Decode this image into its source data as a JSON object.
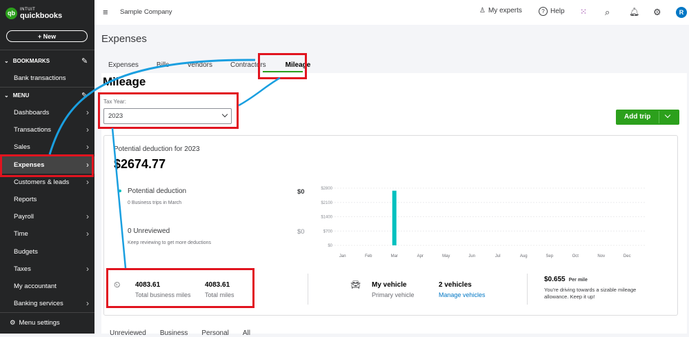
{
  "app": {
    "logo_top": "INTUIT",
    "logo_bottom": "quickbooks",
    "logo_mark": "qb",
    "new_label": "+ New"
  },
  "sidebar": {
    "bookmarks_label": "BOOKMARKS",
    "bank_transactions": "Bank transactions",
    "menu_label": "MENU",
    "items": [
      {
        "label": "Dashboards",
        "chevron": true
      },
      {
        "label": "Transactions",
        "chevron": true
      },
      {
        "label": "Sales",
        "chevron": true
      },
      {
        "label": "Expenses",
        "chevron": true,
        "active": true
      },
      {
        "label": "Customers & leads",
        "chevron": true
      },
      {
        "label": "Reports",
        "chevron": false
      },
      {
        "label": "Payroll",
        "chevron": true
      },
      {
        "label": "Time",
        "chevron": true
      },
      {
        "label": "Budgets",
        "chevron": false
      },
      {
        "label": "Taxes",
        "chevron": true
      },
      {
        "label": "My accountant",
        "chevron": false
      },
      {
        "label": "Banking services",
        "chevron": true
      }
    ],
    "menu_settings": "Menu settings"
  },
  "topbar": {
    "company": "Sample Company",
    "my_experts": "My experts",
    "help": "Help",
    "avatar_initial": "R"
  },
  "page": {
    "title": "Expenses",
    "tabs": [
      "Expenses",
      "Bills",
      "Vendors",
      "Contractors",
      "Mileage"
    ],
    "active_tab": "Mileage"
  },
  "mileage": {
    "title": "Mileage",
    "tax_year_label": "Tax Year:",
    "tax_year_value": "2023",
    "add_trip_label": "Add trip",
    "potential_title": "Potential deduction for 2023",
    "potential_amount": "$2674.77",
    "rows": [
      {
        "label": "Potential deduction",
        "sub": "0 Business trips in March",
        "value": "$0"
      },
      {
        "label": "0 Unreviewed",
        "sub": "Keep reviewing to get more deductions",
        "value": "$0"
      }
    ]
  },
  "chart_data": {
    "type": "bar",
    "categories": [
      "Jan",
      "Feb",
      "Mar",
      "Apr",
      "May",
      "Jun",
      "Jul",
      "Aug",
      "Sep",
      "Oct",
      "Nov",
      "Dec"
    ],
    "values": [
      0,
      0,
      2674.77,
      0,
      0,
      0,
      0,
      0,
      0,
      0,
      0,
      0
    ],
    "y_ticks": [
      "$2800",
      "$2100",
      "$1400",
      "$700",
      "$0"
    ],
    "ylim": [
      0,
      2800
    ],
    "bar_color": "#00c1bf"
  },
  "stats": {
    "business_miles": "4083.61",
    "business_miles_label": "Total business miles",
    "total_miles": "4083.61",
    "total_miles_label": "Total miles",
    "vehicle_title": "My vehicle",
    "vehicle_sub": "Primary vehicle",
    "vehicle_count": "2 vehicles",
    "manage_vehicles": "Manage vehicles",
    "rate": "$0.655",
    "rate_unit": "Per mile",
    "rate_note_1": "You're driving towards a sizable mileage",
    "rate_note_2": "allowance. Keep it up!"
  },
  "bottom_tabs": [
    "Unreviewed",
    "Business",
    "Personal",
    "All"
  ],
  "colors": {
    "sidebar": "#242526",
    "accent": "#2ca01c",
    "highlight": "#e1141f",
    "arrow": "#1a9fe0"
  }
}
